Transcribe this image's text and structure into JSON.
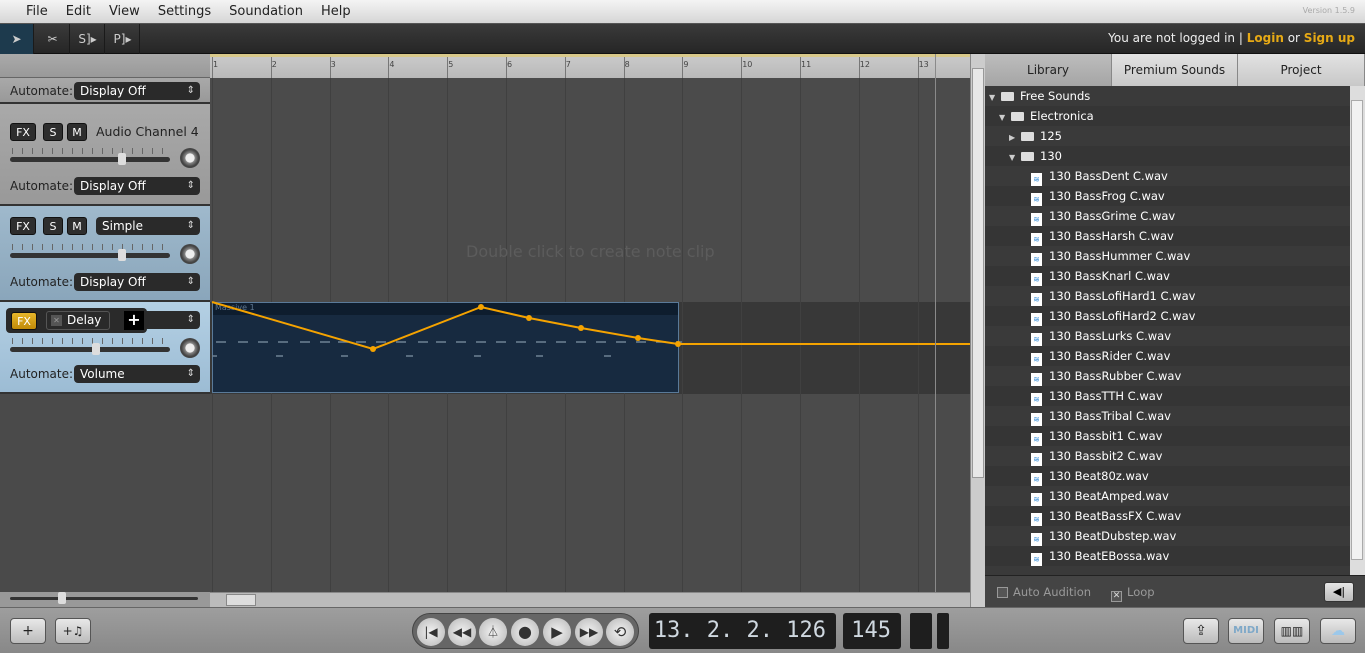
{
  "menu": [
    "File",
    "Edit",
    "View",
    "Settings",
    "Soundation",
    "Help"
  ],
  "version": "Version 1.5.9",
  "login": {
    "text": "You are not logged in |",
    "login": "Login",
    "or": "or",
    "signup": "Sign up"
  },
  "tools": [
    "pointer-tool",
    "cut-tool",
    "S",
    "P"
  ],
  "tracks": {
    "automate_label": "Automate:",
    "t1": {
      "automate": "Display Off"
    },
    "t2": {
      "fx": "FX",
      "s": "S",
      "m": "M",
      "name": "Audio Channel 4",
      "automate": "Display Off"
    },
    "t3": {
      "fx": "FX",
      "s": "S",
      "m": "M",
      "instrument": "Simple",
      "automate": "Display Off"
    },
    "t4": {
      "fx": "FX",
      "effect": "Delay",
      "add": "+",
      "automate": "Volume"
    }
  },
  "timeline": {
    "bars": [
      "1",
      "2",
      "3",
      "4",
      "5",
      "6",
      "7",
      "8",
      "9",
      "10",
      "11",
      "12",
      "13"
    ],
    "hint": "Double click to create note clip",
    "clip_name": "Massive 1"
  },
  "library": {
    "tabs": [
      "Library",
      "Premium Sounds",
      "Project"
    ],
    "root": "Free Sounds",
    "genre": "Electronica",
    "folders": [
      "125",
      "130"
    ],
    "files": [
      "130 BassDent C.wav",
      "130 BassFrog C.wav",
      "130 BassGrime C.wav",
      "130 BassHarsh C.wav",
      "130 BassHummer C.wav",
      "130 BassKnarl C.wav",
      "130 BassLofiHard1 C.wav",
      "130 BassLofiHard2 C.wav",
      "130 BassLurks C.wav",
      "130 BassRider C.wav",
      "130 BassRubber C.wav",
      "130 BassTTH C.wav",
      "130 BassTribal C.wav",
      "130 Bassbit1 C.wav",
      "130 Bassbit2 C.wav",
      "130 Beat80z.wav",
      "130 BeatAmped.wav",
      "130 BeatBassFX C.wav",
      "130 BeatDubstep.wav",
      "130 BeatEBossa.wav"
    ],
    "auto_audition": "Auto Audition",
    "loop": "Loop"
  },
  "transport": {
    "position": "13. 2. 2. 126",
    "tempo": "145"
  },
  "colors": {
    "accent": "#e6a915",
    "automation": "#f5a300"
  }
}
